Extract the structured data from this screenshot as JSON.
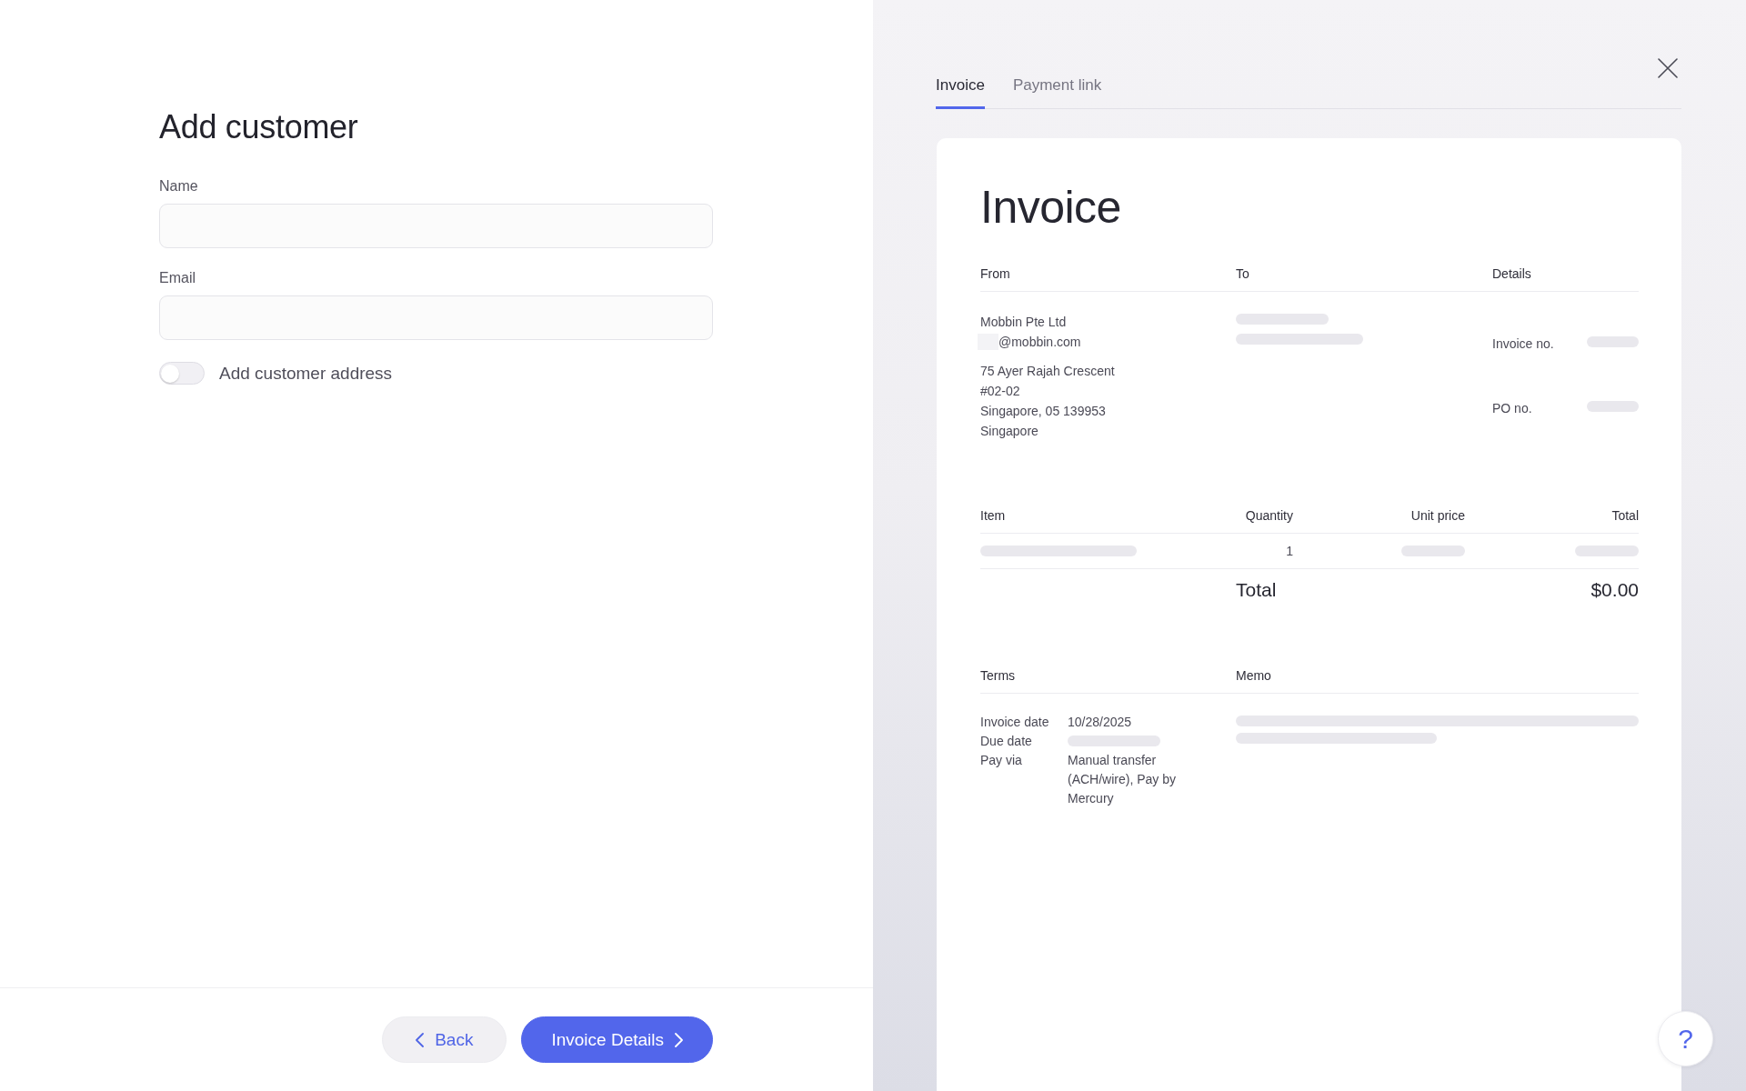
{
  "form": {
    "title": "Add customer",
    "fields": [
      {
        "label": "Name"
      },
      {
        "label": "Email"
      }
    ],
    "address_toggle": {
      "label": "Add customer address",
      "on": false
    }
  },
  "footer": {
    "buttons": [
      {
        "label": "Back",
        "kind": "secondary"
      },
      {
        "label": "Invoice Details",
        "kind": "primary"
      }
    ]
  },
  "preview": {
    "tabs": [
      {
        "label": "Invoice",
        "selected": true
      },
      {
        "label": "Payment link",
        "selected": false
      }
    ],
    "invoice": {
      "title": "Invoice",
      "parties": {
        "headings": [
          "From",
          "To",
          "Details"
        ],
        "from": {
          "name": "Mobbin Pte Ltd",
          "email": "@mobbin.com",
          "address": [
            "75 Ayer Rajah Crescent",
            "#02-02",
            "Singapore, 05 139953",
            "Singapore"
          ]
        },
        "details": [
          {
            "label": "Invoice no."
          },
          {
            "label": "PO no."
          }
        ]
      },
      "items": {
        "columns": [
          "Item",
          "Quantity",
          "Unit price",
          "Total"
        ],
        "rows": [
          {
            "quantity": "1"
          }
        ],
        "total_label": "Total",
        "total_value": "$0.00"
      },
      "terms": {
        "headings": [
          "Terms",
          "Memo"
        ],
        "rows": [
          {
            "label": "Invoice date",
            "value": "10/28/2025"
          },
          {
            "label": "Due date"
          },
          {
            "label": "Pay via",
            "value": "Manual transfer (ACH/wire), Pay by Mercury"
          }
        ]
      }
    },
    "help_button": {
      "label": "?"
    }
  }
}
